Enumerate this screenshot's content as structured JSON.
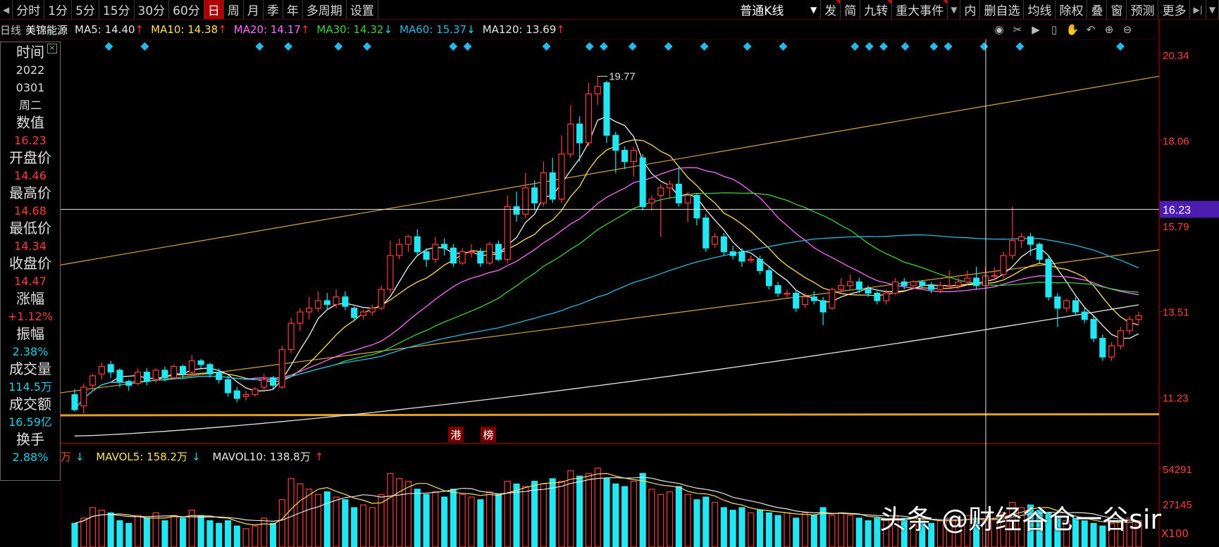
{
  "toolbar": {
    "period_tabs": [
      "分时",
      "1分",
      "5分",
      "15分",
      "30分",
      "60分",
      "日",
      "周",
      "月",
      "季",
      "年",
      "多周期",
      "设置"
    ],
    "active_tab": "日",
    "kline_type": "普通K线",
    "right_tools": [
      "发",
      "简",
      "九转",
      "重大事件",
      "内",
      "删自选",
      "均线",
      "除权",
      "叠",
      "窗",
      "预测",
      "更多"
    ],
    "marked_tools": [
      "发",
      "九转",
      "重大事件"
    ]
  },
  "ma_bar": {
    "prefix": "日线",
    "stock_name": "美锦能源",
    "items": [
      {
        "label": "MA5: 14.40",
        "dir": "↑",
        "color": "#e6e6e6"
      },
      {
        "label": "MA10: 14.38",
        "dir": "↑",
        "color": "#ffe15a"
      },
      {
        "label": "MA20: 14.17",
        "dir": "↑",
        "color": "#ff6cff"
      },
      {
        "label": "MA30: 14.32",
        "dir": "↓",
        "color": "#3ad43a"
      },
      {
        "label": "MA60: 15.37",
        "dir": "↓",
        "color": "#2ab8e0"
      },
      {
        "label": "MA120: 13.69",
        "dir": "↑",
        "color": "#e6e6e6"
      }
    ]
  },
  "chart_icons": [
    "eye-icon",
    "scissors-icon",
    "play-icon",
    "bookmark-icon",
    "hand-icon",
    "undo-icon",
    "zoom-in-icon",
    "zoom-out-icon"
  ],
  "info_panel": {
    "rows": [
      {
        "label": "时间",
        "values": [
          "2022",
          "0301",
          "周二"
        ],
        "color": "white"
      },
      {
        "label": "数值",
        "values": [
          "16.23"
        ],
        "color": "red"
      },
      {
        "label": "开盘价",
        "values": [
          "14.46"
        ],
        "color": "red"
      },
      {
        "label": "最高价",
        "values": [
          "14.68"
        ],
        "color": "red"
      },
      {
        "label": "最低价",
        "values": [
          "14.34"
        ],
        "color": "red"
      },
      {
        "label": "收盘价",
        "values": [
          "14.47"
        ],
        "color": "red"
      },
      {
        "label": "涨幅",
        "values": [
          "+1.12%"
        ],
        "color": "red"
      },
      {
        "label": "振幅",
        "values": [
          "2.38%"
        ],
        "color": "cyan"
      },
      {
        "label": "成交量",
        "values": [
          "114.5万"
        ],
        "color": "cyan"
      },
      {
        "label": "成交额",
        "values": [
          "16.59亿"
        ],
        "color": "cyan"
      },
      {
        "label": "换手",
        "values": [
          "2.88%"
        ],
        "color": "cyan"
      }
    ]
  },
  "volume_header": {
    "unit": "万",
    "unit_dir": "↓",
    "mavol5": "MAVOL5: 158.2万",
    "mavol5_dir": "↓",
    "mavol10": "MAVOL10: 138.8万",
    "mavol10_dir": "↑"
  },
  "volume_axis": {
    "top_label": "54291",
    "mid_label": "27145",
    "unit_label": "X100"
  },
  "watermark": "头条 @财经谷仓一谷sir",
  "tags": [
    "港",
    "榜"
  ],
  "colors": {
    "up": "#ff3c3c",
    "down": "#22e6f2",
    "grid": "#8a0000",
    "axis_text": "#ff4040",
    "crosshair_price_bg": "#4c1bb0"
  },
  "chart_data": {
    "type": "candlestick",
    "price_axis_ticks": [
      "20.34",
      "18.06",
      "15.79",
      "13.51",
      "11.23"
    ],
    "price_axis_values": [
      20.34,
      18.06,
      15.79,
      13.51,
      11.23
    ],
    "crosshair_value": "16.23",
    "max_annotation": "19.77",
    "candles": [
      [
        11.3,
        10.9,
        11.45,
        10.85
      ],
      [
        11.0,
        11.5,
        11.6,
        10.8
      ],
      [
        11.55,
        11.8,
        11.85,
        11.4
      ],
      [
        11.85,
        12.05,
        12.15,
        11.7
      ],
      [
        12.1,
        11.9,
        12.2,
        11.75
      ],
      [
        11.95,
        11.65,
        12.0,
        11.5
      ],
      [
        11.65,
        11.55,
        11.7,
        11.4
      ],
      [
        11.6,
        11.9,
        12.0,
        11.55
      ],
      [
        11.9,
        11.65,
        12.0,
        11.55
      ],
      [
        11.7,
        11.95,
        12.0,
        11.6
      ],
      [
        11.95,
        11.75,
        12.05,
        11.65
      ],
      [
        11.75,
        12.05,
        12.1,
        11.7
      ],
      [
        12.05,
        11.85,
        12.1,
        11.75
      ],
      [
        11.9,
        12.2,
        12.35,
        11.85
      ],
      [
        12.2,
        12.1,
        12.25,
        12.0
      ],
      [
        12.1,
        11.85,
        12.15,
        11.75
      ],
      [
        11.9,
        11.7,
        12.0,
        11.6
      ],
      [
        11.7,
        11.35,
        11.8,
        11.25
      ],
      [
        11.4,
        11.2,
        11.5,
        11.1
      ],
      [
        11.25,
        11.3,
        11.4,
        11.15
      ],
      [
        11.3,
        11.45,
        11.5,
        11.25
      ],
      [
        11.5,
        11.7,
        11.85,
        11.4
      ],
      [
        11.75,
        11.55,
        11.8,
        11.45
      ],
      [
        11.5,
        12.5,
        12.6,
        11.45
      ],
      [
        12.5,
        13.2,
        13.35,
        12.4
      ],
      [
        13.2,
        13.5,
        13.6,
        13.0
      ],
      [
        13.5,
        13.6,
        13.9,
        13.3
      ],
      [
        13.6,
        13.8,
        14.05,
        13.5
      ],
      [
        13.8,
        13.7,
        14.0,
        13.55
      ],
      [
        13.7,
        13.9,
        14.1,
        13.6
      ],
      [
        13.9,
        13.65,
        14.05,
        13.55
      ],
      [
        13.6,
        13.35,
        13.65,
        13.25
      ],
      [
        13.4,
        13.5,
        13.55,
        13.3
      ],
      [
        13.5,
        13.6,
        13.7,
        13.4
      ],
      [
        13.6,
        14.1,
        14.2,
        13.55
      ],
      [
        14.1,
        15.0,
        15.4,
        14.0
      ],
      [
        15.0,
        15.3,
        15.45,
        14.9
      ],
      [
        15.3,
        15.5,
        15.55,
        15.1
      ],
      [
        15.5,
        15.1,
        15.7,
        15.0
      ],
      [
        15.1,
        14.9,
        15.2,
        14.7
      ],
      [
        14.9,
        15.3,
        15.5,
        14.8
      ],
      [
        15.3,
        15.2,
        15.45,
        15.0
      ],
      [
        15.2,
        14.8,
        15.3,
        14.7
      ],
      [
        14.8,
        15.1,
        15.2,
        14.75
      ],
      [
        15.1,
        15.1,
        15.3,
        14.95
      ],
      [
        15.1,
        14.8,
        15.2,
        14.7
      ],
      [
        14.8,
        15.3,
        15.35,
        14.75
      ],
      [
        15.3,
        14.9,
        15.4,
        14.85
      ],
      [
        14.9,
        16.3,
        16.6,
        14.8
      ],
      [
        16.3,
        16.1,
        16.7,
        15.9
      ],
      [
        16.1,
        16.8,
        17.2,
        16.0
      ],
      [
        16.8,
        16.4,
        17.0,
        16.2
      ],
      [
        16.4,
        17.2,
        17.5,
        16.3
      ],
      [
        17.2,
        16.5,
        17.6,
        16.4
      ],
      [
        16.5,
        17.7,
        18.2,
        16.4
      ],
      [
        17.7,
        18.5,
        19.0,
        17.6
      ],
      [
        18.5,
        18.0,
        18.7,
        17.5
      ],
      [
        18.0,
        19.3,
        19.6,
        17.9
      ],
      [
        19.3,
        19.5,
        19.77,
        19.0
      ],
      [
        19.6,
        18.2,
        19.65,
        18.0
      ],
      [
        18.2,
        17.8,
        18.3,
        17.2
      ],
      [
        17.8,
        17.5,
        17.9,
        17.3
      ],
      [
        17.5,
        17.8,
        17.9,
        17.1
      ],
      [
        17.6,
        16.3,
        17.7,
        16.2
      ],
      [
        16.4,
        16.5,
        16.6,
        16.2
      ],
      [
        16.6,
        16.8,
        16.9,
        15.5
      ],
      [
        16.8,
        16.9,
        17.0,
        16.5
      ],
      [
        16.9,
        16.4,
        17.35,
        16.3
      ],
      [
        16.4,
        16.6,
        16.7,
        15.9
      ],
      [
        16.6,
        16.0,
        16.65,
        15.8
      ],
      [
        16.0,
        15.2,
        16.1,
        15.1
      ],
      [
        15.3,
        15.5,
        15.6,
        15.2
      ],
      [
        15.5,
        15.1,
        15.6,
        15.0
      ],
      [
        15.1,
        15.0,
        15.25,
        14.9
      ],
      [
        15.1,
        14.85,
        15.2,
        14.7
      ],
      [
        14.9,
        14.9,
        15.0,
        14.8
      ],
      [
        14.9,
        14.6,
        15.0,
        14.5
      ],
      [
        14.6,
        14.2,
        14.7,
        14.1
      ],
      [
        14.2,
        14.0,
        14.3,
        13.9
      ],
      [
        14.0,
        14.0,
        14.1,
        13.85
      ],
      [
        14.0,
        13.6,
        14.1,
        13.5
      ],
      [
        13.7,
        13.9,
        14.0,
        13.6
      ],
      [
        13.9,
        13.8,
        14.05,
        13.7
      ],
      [
        13.8,
        13.5,
        13.9,
        13.15
      ],
      [
        13.6,
        14.1,
        14.15,
        13.55
      ],
      [
        14.1,
        14.2,
        14.4,
        14.0
      ],
      [
        14.2,
        14.3,
        14.5,
        14.1
      ],
      [
        14.3,
        14.1,
        14.4,
        14.0
      ],
      [
        14.1,
        14.0,
        14.2,
        13.9
      ],
      [
        14.0,
        13.8,
        14.05,
        13.7
      ],
      [
        13.8,
        14.0,
        14.1,
        13.7
      ],
      [
        14.0,
        14.3,
        14.4,
        13.95
      ],
      [
        14.3,
        14.2,
        14.4,
        14.1
      ],
      [
        14.2,
        14.3,
        14.35,
        14.1
      ],
      [
        14.3,
        14.2,
        14.35,
        14.15
      ],
      [
        14.2,
        14.1,
        14.3,
        14.0
      ],
      [
        14.1,
        14.2,
        14.3,
        14.0
      ],
      [
        14.2,
        14.2,
        14.6,
        14.1
      ],
      [
        14.2,
        14.3,
        14.4,
        14.1
      ],
      [
        14.3,
        14.4,
        14.6,
        14.2
      ],
      [
        14.4,
        14.2,
        14.7,
        14.1
      ],
      [
        14.2,
        14.46,
        14.68,
        14.34
      ],
      [
        14.46,
        14.47,
        14.68,
        14.34
      ],
      [
        14.5,
        15.0,
        15.1,
        14.4
      ],
      [
        15.0,
        15.4,
        16.3,
        14.9
      ],
      [
        15.4,
        15.5,
        15.6,
        15.2
      ],
      [
        15.5,
        15.3,
        15.6,
        15.0
      ],
      [
        15.3,
        14.9,
        15.35,
        14.8
      ],
      [
        14.9,
        13.9,
        15.0,
        13.8
      ],
      [
        13.9,
        13.6,
        14.0,
        13.1
      ],
      [
        13.6,
        13.8,
        13.85,
        13.5
      ],
      [
        13.8,
        13.5,
        13.9,
        13.4
      ],
      [
        13.5,
        13.3,
        13.6,
        13.2
      ],
      [
        13.3,
        12.8,
        13.4,
        12.7
      ],
      [
        12.8,
        12.3,
        12.9,
        12.2
      ],
      [
        12.3,
        12.6,
        12.7,
        12.2
      ],
      [
        12.6,
        13.0,
        13.1,
        12.5
      ],
      [
        13.0,
        13.3,
        13.4,
        12.9
      ],
      [
        13.3,
        13.4,
        13.5,
        13.2
      ]
    ],
    "volume": [
      18,
      22,
      30,
      28,
      26,
      20,
      18,
      24,
      22,
      26,
      20,
      24,
      22,
      28,
      24,
      20,
      18,
      20,
      16,
      14,
      16,
      22,
      18,
      36,
      52,
      48,
      44,
      40,
      42,
      38,
      36,
      30,
      32,
      30,
      40,
      56,
      52,
      50,
      44,
      40,
      42,
      38,
      44,
      40,
      38,
      36,
      42,
      40,
      50,
      48,
      46,
      50,
      48,
      52,
      50,
      58,
      54,
      56,
      60,
      52,
      48,
      46,
      50,
      56,
      44,
      40,
      42,
      46,
      40,
      36,
      38,
      34,
      30,
      28,
      30,
      26,
      28,
      26,
      24,
      26,
      22,
      26,
      24,
      30,
      24,
      26,
      24,
      22,
      20,
      22,
      20,
      24,
      22,
      20,
      20,
      18,
      20,
      22,
      20,
      24,
      22,
      20,
      22,
      26,
      34,
      30,
      32,
      28,
      26,
      22,
      20,
      22,
      20,
      18,
      16,
      18,
      20,
      22,
      20
    ],
    "volume_ylim": [
      0,
      60
    ],
    "ylim": [
      10.0,
      20.75
    ]
  }
}
